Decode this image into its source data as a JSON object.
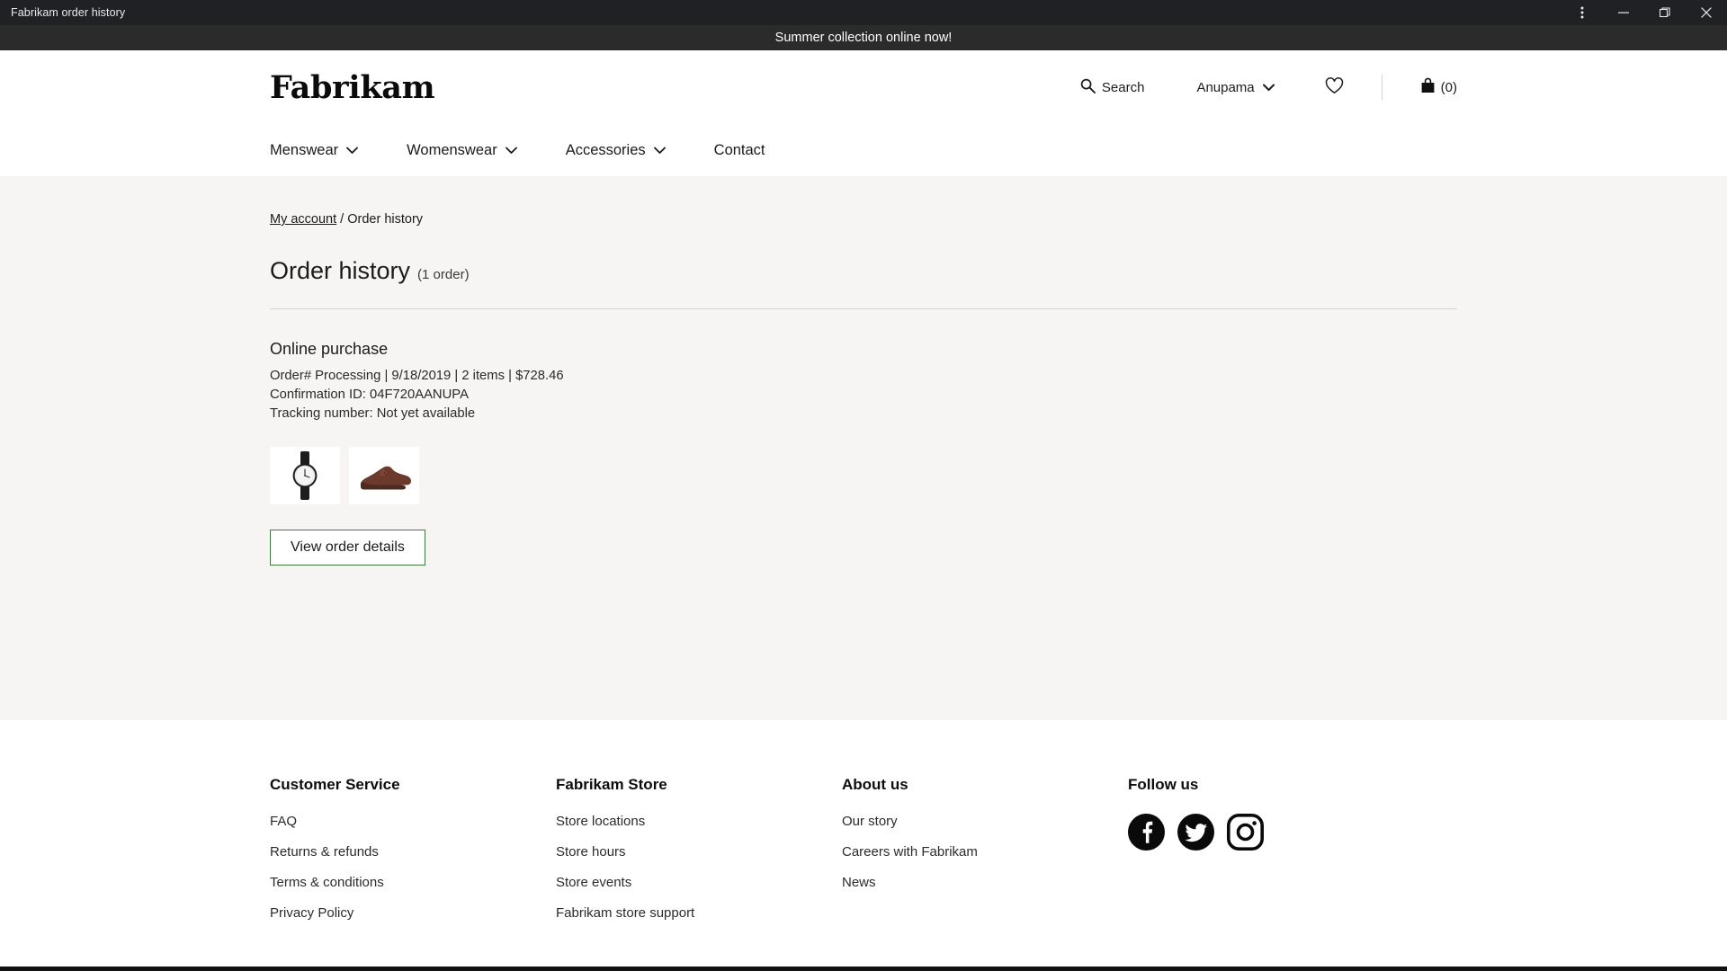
{
  "window": {
    "title": "Fabrikam order history",
    "controls": [
      {
        "name": "more-options",
        "glyph": "kebab"
      },
      {
        "name": "minimize",
        "glyph": "minimize"
      },
      {
        "name": "restore",
        "glyph": "restore"
      },
      {
        "name": "close",
        "glyph": "close"
      }
    ]
  },
  "promo": {
    "text": "Summer collection online now!"
  },
  "header": {
    "logo": "Fabrikam",
    "search_label": "Search",
    "account_name": "Anupama",
    "cart_count": "(0)"
  },
  "nav": {
    "items": [
      {
        "label": "Menswear",
        "has_chevron": true
      },
      {
        "label": "Womenswear",
        "has_chevron": true
      },
      {
        "label": "Accessories",
        "has_chevron": true
      },
      {
        "label": "Contact",
        "has_chevron": false
      }
    ]
  },
  "breadcrumb": {
    "link": "My account",
    "separator": "/",
    "current": "Order history"
  },
  "page": {
    "title": "Order history",
    "count": "(1 order)"
  },
  "order": {
    "type": "Online purchase",
    "meta_line": "Order# Processing | 9/18/2019 | 2 items | $728.46",
    "confirmation": "Confirmation ID: 04F720AANUPA",
    "tracking": "Tracking number: Not yet available",
    "items": [
      {
        "name": "wristwatch-thumbnail"
      },
      {
        "name": "dress-shoe-thumbnail"
      }
    ],
    "details_button": "View order details"
  },
  "footer": {
    "columns": [
      {
        "heading": "Customer Service",
        "links": [
          "FAQ",
          "Returns & refunds",
          "Terms & conditions",
          "Privacy Policy"
        ]
      },
      {
        "heading": "Fabrikam Store",
        "links": [
          "Store locations",
          "Store hours",
          "Store events",
          "Fabrikam store support"
        ]
      },
      {
        "heading": "About us",
        "links": [
          "Our story",
          "Careers with Fabrikam",
          "News"
        ]
      }
    ],
    "follow": {
      "heading": "Follow us",
      "socials": [
        "facebook-icon",
        "twitter-icon",
        "instagram-icon"
      ]
    }
  },
  "colors": {
    "titlebar": "#202124",
    "promo": "#2b2b2b",
    "content_bg": "#f7f5f3",
    "accent_green": "#3c7d3c",
    "text": "#1b1b1b"
  }
}
